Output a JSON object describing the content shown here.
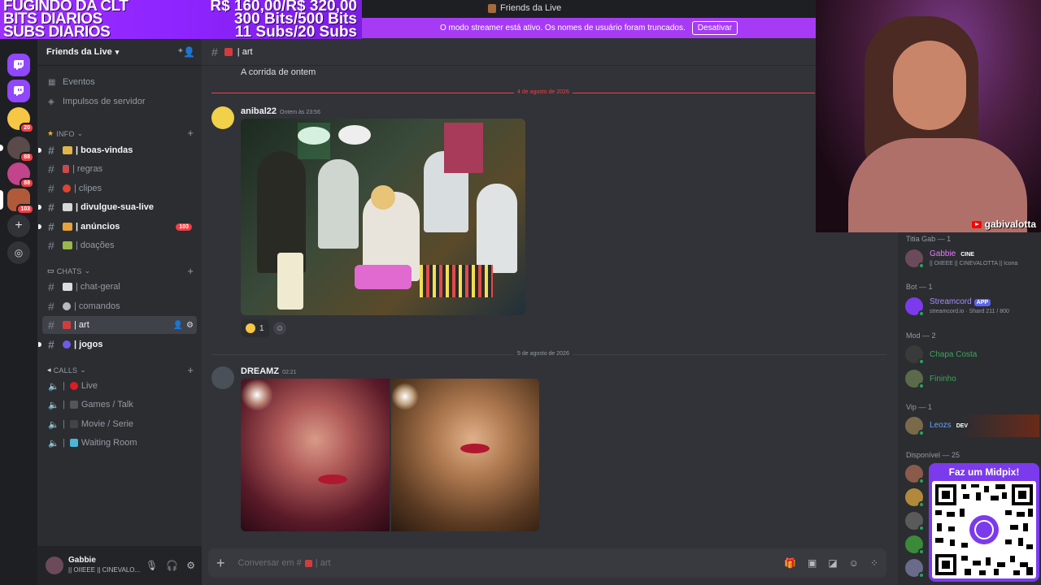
{
  "window": {
    "title": "Friends da Live"
  },
  "overlay": {
    "lines_left": [
      "FUGINDO DA CLT",
      "BITS DIARIOS",
      "SUBS DIARIOS"
    ],
    "lines_right": [
      "R$ 160,00/R$ 320,00",
      "300 Bits/500 Bits",
      "11 Subs/20 Subs"
    ]
  },
  "streamer_banner": {
    "text": "O modo streamer está ativo. Os nomes de usuário foram truncados.",
    "button": "Desativar"
  },
  "rail": {
    "badges": [
      "20",
      "88",
      "88",
      "103"
    ]
  },
  "server": {
    "name": "Friends da Live"
  },
  "sidebar": {
    "top_items": [
      {
        "label": "Eventos",
        "icon": "calendar-icon"
      },
      {
        "label": "Impulsos de servidor",
        "icon": "boost-icon"
      }
    ],
    "categories": [
      {
        "name": "INFO",
        "channels": [
          {
            "label": "| boas-vindas",
            "unread": true
          },
          {
            "label": "| regras",
            "unread": false
          },
          {
            "label": "| clipes",
            "unread": false
          },
          {
            "label": "| divulgue-sua-live",
            "unread": true
          },
          {
            "label": "| anúncios",
            "unread": true,
            "badge": "103"
          },
          {
            "label": "| doações",
            "unread": false
          }
        ]
      },
      {
        "name": "CHATS",
        "channels": [
          {
            "label": "| chat-geral",
            "unread": false
          },
          {
            "label": "| comandos",
            "unread": false
          },
          {
            "label": "| art",
            "active": true
          },
          {
            "label": "| jogos",
            "unread": true
          }
        ]
      },
      {
        "name": "CALLS",
        "channels": [
          {
            "label": "Live"
          },
          {
            "label": "Games / Talk"
          },
          {
            "label": "Movie / Serie"
          },
          {
            "label": "Waiting Room"
          }
        ]
      }
    ]
  },
  "user_panel": {
    "name": "Gabbie",
    "status": "|| OIIEEE || CINEVALO..."
  },
  "channel": {
    "name": "| art",
    "composer_placeholder": "Conversar em #",
    "composer_channel": "| art"
  },
  "messages": {
    "prev_text": "A corrida de ontem",
    "date1": "4 de agosto de 2026",
    "msg1": {
      "author": "anibal22",
      "time": "Ontem às 23:56",
      "reaction_count": "1"
    },
    "date2": "5 de agosto de 2026",
    "msg2": {
      "author": "DREAMZ",
      "time": "02:21"
    }
  },
  "members": {
    "groups": [
      {
        "name": "Titia Gab — 1",
        "top": 0
      },
      {
        "name": "Bot — 1"
      },
      {
        "name": "Mod — 2"
      },
      {
        "name": "Vip — 1"
      },
      {
        "name": "Disponível — 25"
      }
    ],
    "gabbie": {
      "name": "Gabbie",
      "tag": "CINE",
      "sub": "|| OIIEEE || CINEVALOTTA || Icona"
    },
    "bot": {
      "name": "Streamcord",
      "tag": "APP",
      "sub": "streamcord.io · Shard 211 / 800"
    },
    "mod1": {
      "name": "Chapa Costa"
    },
    "mod2": {
      "name": "Fininho"
    },
    "vip": {
      "name": "Leozs",
      "tag": "DEV"
    }
  },
  "webcam": {
    "handle": "gabivalotta"
  },
  "pix": {
    "title": "Faz um Midpix!"
  },
  "colors": {
    "accent": "#a73bf5",
    "overlay": "#9b30ff",
    "unread_badge": "#f23f43",
    "mod": "#3ba55c",
    "bot": "#5865f2"
  }
}
